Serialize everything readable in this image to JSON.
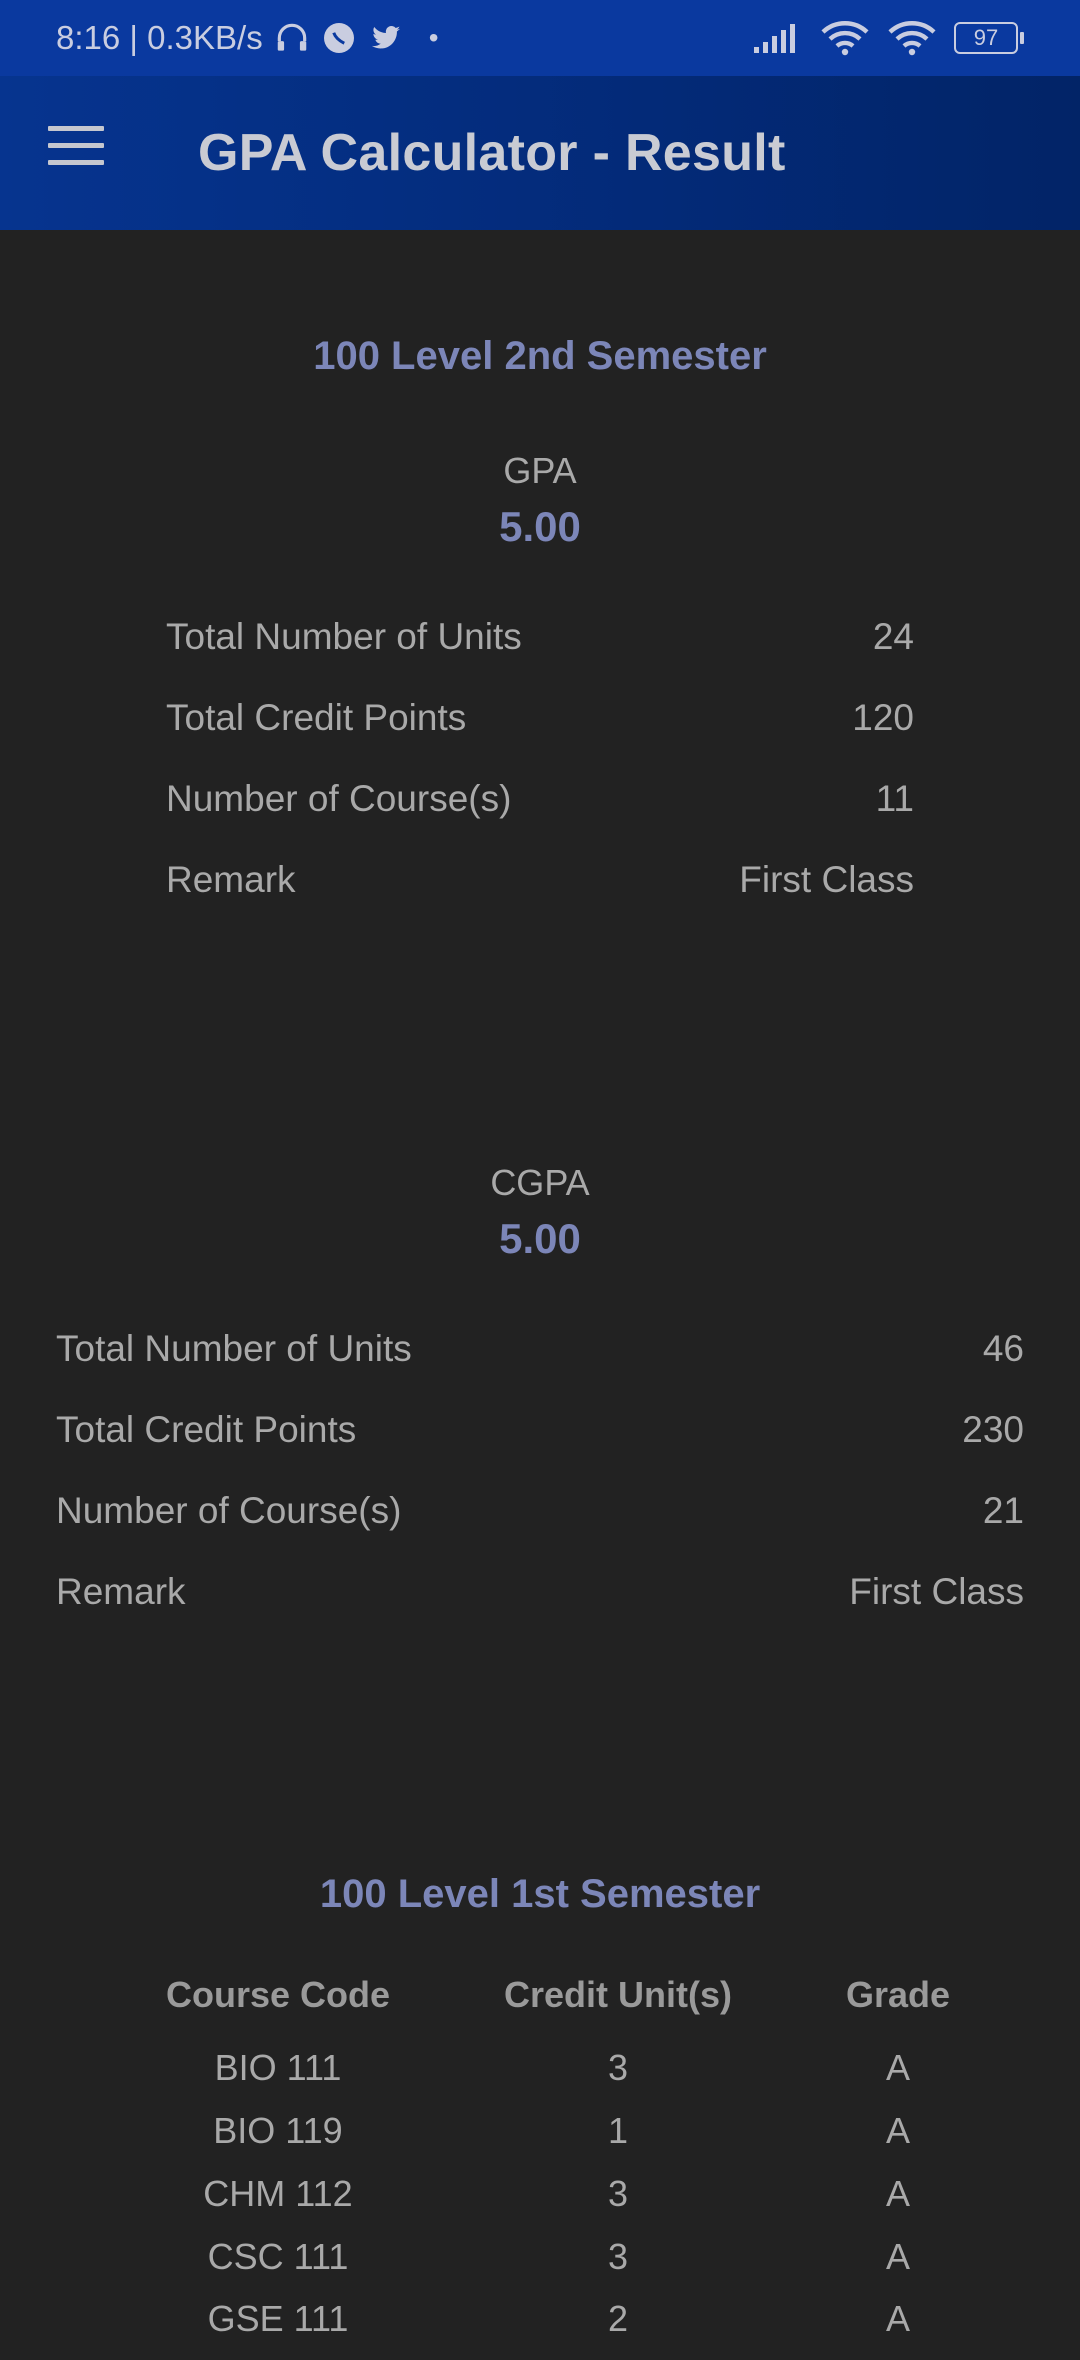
{
  "status_bar": {
    "time_speed": "8:16 | 0.3KB/s",
    "battery": "97"
  },
  "app_bar": {
    "title": "GPA Calculator - Result"
  },
  "semester_result": {
    "title": "100 Level 2nd Semester",
    "gpa_label": "GPA",
    "gpa_value": "5.00",
    "rows": [
      {
        "label": "Total Number of Units",
        "value": "24"
      },
      {
        "label": "Total Credit Points",
        "value": "120"
      },
      {
        "label": "Number of Course(s)",
        "value": "11"
      },
      {
        "label": "Remark",
        "value": "First Class"
      }
    ]
  },
  "cumulative_result": {
    "cgpa_label": "CGPA",
    "cgpa_value": "5.00",
    "rows": [
      {
        "label": "Total Number of Units",
        "value": "46"
      },
      {
        "label": "Total Credit Points",
        "value": "230"
      },
      {
        "label": "Number of Course(s)",
        "value": "21"
      },
      {
        "label": "Remark",
        "value": "First Class"
      }
    ]
  },
  "course_table": {
    "title": "100 Level 1st Semester",
    "headers": [
      "Course Code",
      "Credit Unit(s)",
      "Grade"
    ],
    "rows": [
      [
        "BIO 111",
        "3",
        "A"
      ],
      [
        "BIO 119",
        "1",
        "A"
      ],
      [
        "CHM 112",
        "3",
        "A"
      ],
      [
        "CSC 111",
        "3",
        "A"
      ],
      [
        "GSE 111",
        "2",
        "A"
      ]
    ]
  }
}
